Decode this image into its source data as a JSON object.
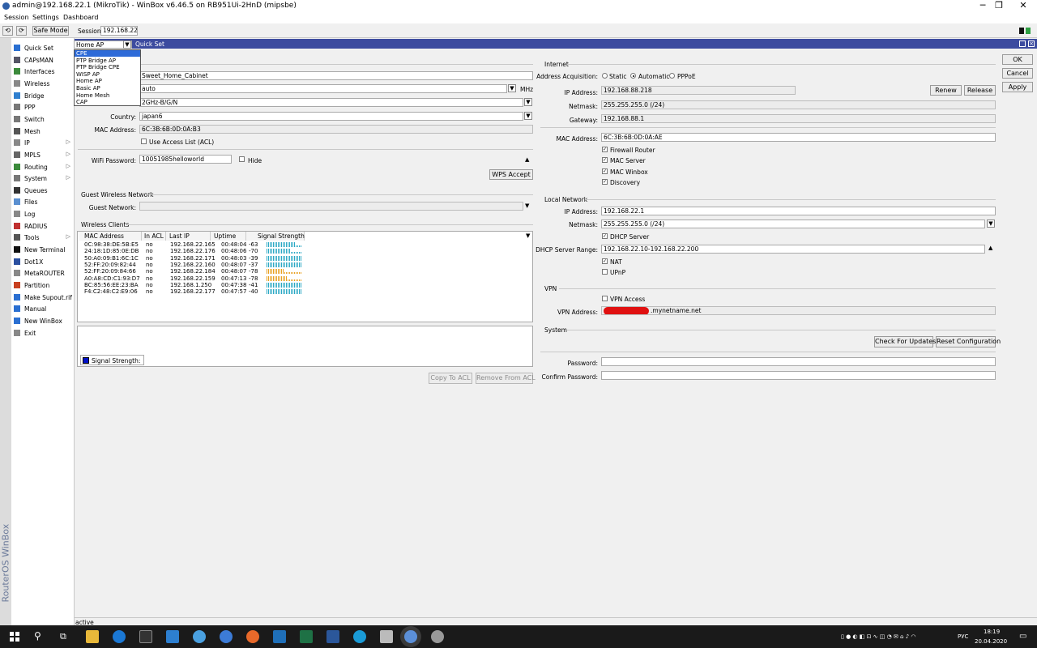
{
  "window": {
    "title": "admin@192.168.22.1 (MikroTik) - WinBox v6.46.5 on RB951Ui-2HnD (mipsbe)"
  },
  "menu": {
    "session": "Session",
    "settings": "Settings",
    "dashboard": "Dashboard"
  },
  "toolbar": {
    "safe_mode": "Safe Mode",
    "session_label": "Session:",
    "session_value": "192.168.22.1"
  },
  "sidebar": {
    "brand": "RouterOS WinBox",
    "items": [
      {
        "label": "Quick Set",
        "icon": "quick-set-icon",
        "arrow": ""
      },
      {
        "label": "CAPsMAN",
        "icon": "capsman-icon",
        "arrow": ""
      },
      {
        "label": "Interfaces",
        "icon": "interfaces-icon",
        "arrow": ""
      },
      {
        "label": "Wireless",
        "icon": "wireless-icon",
        "arrow": ""
      },
      {
        "label": "Bridge",
        "icon": "bridge-icon",
        "arrow": ""
      },
      {
        "label": "PPP",
        "icon": "ppp-icon",
        "arrow": ""
      },
      {
        "label": "Switch",
        "icon": "switch-icon",
        "arrow": ""
      },
      {
        "label": "Mesh",
        "icon": "mesh-icon",
        "arrow": ""
      },
      {
        "label": "IP",
        "icon": "ip-icon",
        "arrow": "▷"
      },
      {
        "label": "MPLS",
        "icon": "mpls-icon",
        "arrow": "▷"
      },
      {
        "label": "Routing",
        "icon": "routing-icon",
        "arrow": "▷"
      },
      {
        "label": "System",
        "icon": "system-icon",
        "arrow": "▷"
      },
      {
        "label": "Queues",
        "icon": "queues-icon",
        "arrow": ""
      },
      {
        "label": "Files",
        "icon": "files-icon",
        "arrow": ""
      },
      {
        "label": "Log",
        "icon": "log-icon",
        "arrow": ""
      },
      {
        "label": "RADIUS",
        "icon": "radius-icon",
        "arrow": ""
      },
      {
        "label": "Tools",
        "icon": "tools-icon",
        "arrow": "▷"
      },
      {
        "label": "New Terminal",
        "icon": "terminal-icon",
        "arrow": ""
      },
      {
        "label": "Dot1X",
        "icon": "dot1x-icon",
        "arrow": ""
      },
      {
        "label": "MetaROUTER",
        "icon": "metarouter-icon",
        "arrow": ""
      },
      {
        "label": "Partition",
        "icon": "partition-icon",
        "arrow": ""
      },
      {
        "label": "Make Supout.rif",
        "icon": "supout-icon",
        "arrow": ""
      },
      {
        "label": "Manual",
        "icon": "manual-icon",
        "arrow": ""
      },
      {
        "label": "New WinBox",
        "icon": "winbox-icon",
        "arrow": ""
      },
      {
        "label": "Exit",
        "icon": "exit-icon",
        "arrow": ""
      }
    ]
  },
  "quickset": {
    "mode_select": "Home AP",
    "header_title": "Quick Set",
    "mode_options": [
      "CPE",
      "PTP Bridge AP",
      "PTP Bridge CPE",
      "WISP AP",
      "Home AP",
      "Basic AP",
      "Home Mesh",
      "CAP"
    ],
    "selected_option": "CPE",
    "buttons": {
      "ok": "OK",
      "cancel": "Cancel",
      "apply": "Apply"
    }
  },
  "wireless": {
    "network_name": "Sweet_Home_Cabinet",
    "frequency": "auto",
    "frequency_unit": "MHz",
    "band": "2GHz-B/G/N",
    "country_label": "Country:",
    "country": "japan6",
    "mac_label": "MAC Address:",
    "mac": "6C:3B:6B:0D:0A:B3",
    "acl_label": "Use Access List (ACL)",
    "wifi_password_label": "WiFi Password:",
    "wifi_password": "10051985helloworld",
    "hide_label": "Hide",
    "wps_button": "WPS Accept",
    "guest_section": "Guest Wireless Network",
    "guest_network_label": "Guest Network:",
    "clients_section": "Wireless Clients",
    "columns": [
      "MAC Address",
      "In ACL",
      "Last IP",
      "Uptime",
      "Signal Strength"
    ],
    "clients": [
      {
        "mac": "0C:98:38:DE:5B:E5",
        "acl": "no",
        "ip": "192.168.22.165",
        "uptime": "00:48:04",
        "signal": "-63",
        "level": 0.8,
        "color": "#2aa8c4"
      },
      {
        "mac": "24:18:1D:85:0E:DB",
        "acl": "no",
        "ip": "192.168.22.176",
        "uptime": "00:48:06",
        "signal": "-70",
        "level": 0.65,
        "color": "#2aa8c4"
      },
      {
        "mac": "50:A0:09:B1:6C:1C",
        "acl": "no",
        "ip": "192.168.22.171",
        "uptime": "00:48:03",
        "signal": "-39",
        "level": 1.0,
        "color": "#2aa8c4"
      },
      {
        "mac": "52:FF:20:09:82:44",
        "acl": "no",
        "ip": "192.168.22.160",
        "uptime": "00:48:07",
        "signal": "-37",
        "level": 1.0,
        "color": "#2aa8c4"
      },
      {
        "mac": "52:FF:20:09:84:66",
        "acl": "no",
        "ip": "192.168.22.184",
        "uptime": "00:48:07",
        "signal": "-78",
        "level": 0.5,
        "color": "#e8a020"
      },
      {
        "mac": "A0:A8:CD:C1:93:D7",
        "acl": "no",
        "ip": "192.168.22.159",
        "uptime": "00:47:13",
        "signal": "-78",
        "level": 0.55,
        "color": "#e8a020"
      },
      {
        "mac": "BC:85:56:EE:23:BA",
        "acl": "no",
        "ip": "192.168.1.250",
        "uptime": "00:47:38",
        "signal": "-41",
        "level": 1.0,
        "color": "#2aa8c4"
      },
      {
        "mac": "F4:C2:48:C2:E9:06",
        "acl": "no",
        "ip": "192.168.22.177",
        "uptime": "00:47:57",
        "signal": "-40",
        "level": 1.0,
        "color": "#2aa8c4"
      }
    ],
    "legend": "Signal Strength:",
    "copy_acl": "Copy To ACL",
    "remove_acl": "Remove From ACL"
  },
  "internet": {
    "section": "Internet",
    "acq_label": "Address Acquisition:",
    "acq_options": [
      "Static",
      "Automatic",
      "PPPoE"
    ],
    "acq_selected": "Automatic",
    "ip_label": "IP Address:",
    "ip": "192.168.88.218",
    "netmask_label": "Netmask:",
    "netmask": "255.255.255.0 (/24)",
    "gateway_label": "Gateway:",
    "gateway": "192.168.88.1",
    "renew": "Renew",
    "release": "Release",
    "mac_label": "MAC Address:",
    "mac": "6C:3B:6B:0D:0A:AE",
    "checks": [
      "Firewall Router",
      "MAC Server",
      "MAC Winbox",
      "Discovery"
    ]
  },
  "local": {
    "section": "Local Network",
    "ip_label": "IP Address:",
    "ip": "192.168.22.1",
    "netmask_label": "Netmask:",
    "netmask": "255.255.255.0 (/24)",
    "dhcp_label": "DHCP Server",
    "range_label": "DHCP Server Range:",
    "range": "192.168.22.10-192.168.22.200",
    "nat_label": "NAT",
    "upnp_label": "UPnP"
  },
  "vpn": {
    "section": "VPN",
    "access_label": "VPN Access",
    "address_label": "VPN Address:",
    "address": ".mynetname.net"
  },
  "system": {
    "section": "System",
    "check_updates": "Check For Updates",
    "reset": "Reset Configuration",
    "password_label": "Password:",
    "confirm_label": "Confirm Password:"
  },
  "status": {
    "text": "active"
  },
  "taskbar": {
    "lang": "РУС",
    "time": "18:19",
    "date": "20.04.2020"
  }
}
